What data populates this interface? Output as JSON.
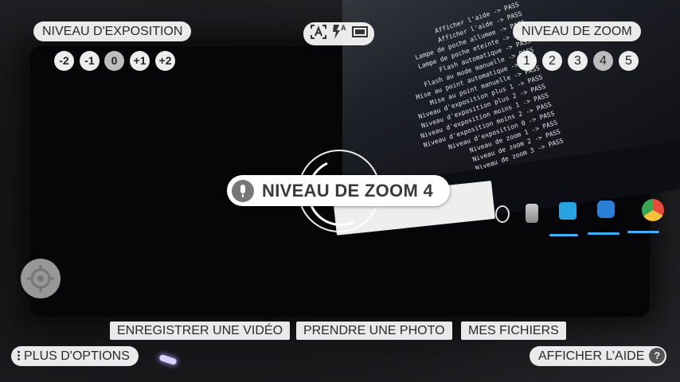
{
  "exposure": {
    "title": "NIVEAU D'EXPOSITION",
    "levels": [
      "-2",
      "-1",
      "0",
      "+1",
      "+2"
    ],
    "selected": "0"
  },
  "zoom": {
    "title": "NIVEAU DE ZOOM",
    "levels": [
      "1",
      "2",
      "3",
      "4",
      "5"
    ],
    "selected": "4"
  },
  "mode_icons": [
    "auto-scene-icon",
    "auto-flash-icon",
    "aspect-ratio-icon"
  ],
  "flash_label": "A",
  "announcement": {
    "icon": "microphone-icon",
    "text": "NIVEAU DE ZOOM 4"
  },
  "bottom_actions": {
    "record_video": "ENREGISTRER UNE VIDÉO",
    "take_photo": "PRENDRE UNE PHOTO",
    "my_files": "MES FICHIERS"
  },
  "more_options": "PLUS D'OPTIONS",
  "help": {
    "label": "AFFICHER L’AIDE",
    "icon_text": "?"
  },
  "viewfinder_code_lines": [
    "Afficher l'aide -> PASS",
    "Afficher l'aide -> PASS",
    "Lampe de poche allumee -> PASS",
    "Lampe de poche eteinte -> PASS",
    "Flash automatique -> PASS",
    "Flash au mode manuelle -> PASS",
    "Mise au point automatique -> PASS",
    "Mise au point manuelle -> PASS",
    "Niveau d'exposition plus 1 -> PASS",
    "Niveau d'exposition plus 2 -> PASS",
    "Niveau d'exposition moins 1 -> PASS",
    "Niveau d'exposition moins 2 -> PASS",
    "Niveau d'exposition 0 -> PASS",
    "Niveau de zoom 1 -> PASS",
    "Niveau de zoom 2 -> PASS",
    "Niveau de zoom 3 -> PASS"
  ]
}
